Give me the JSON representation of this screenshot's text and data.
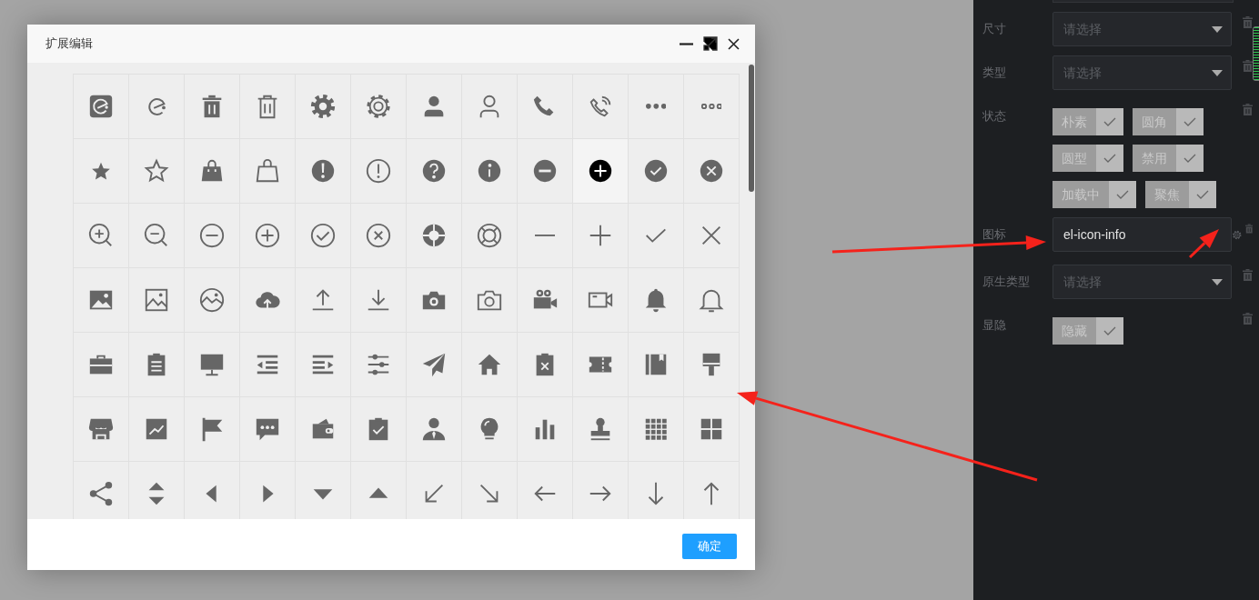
{
  "dialog": {
    "title": "扩展编辑",
    "icon_grid": {
      "rows": [
        {
          "cells": [
            {
              "selected": false
            },
            {
              "selected": false
            },
            {
              "selected": false
            },
            {
              "selected": false
            },
            {
              "selected": false
            },
            {
              "selected": false
            },
            {
              "selected": false
            },
            {
              "selected": false
            },
            {
              "selected": false
            },
            {
              "selected": false
            },
            {
              "selected": false
            },
            {
              "selected": false
            }
          ]
        },
        {
          "cells": [
            {
              "selected": false
            },
            {
              "selected": false
            },
            {
              "selected": false
            },
            {
              "selected": false
            },
            {
              "selected": false
            },
            {
              "selected": false
            },
            {
              "selected": false
            },
            {
              "selected": false
            },
            {
              "selected": false
            },
            {
              "selected": true
            },
            {
              "selected": false
            },
            {
              "selected": false
            }
          ]
        },
        {
          "cells": [
            {
              "selected": false
            },
            {
              "selected": false
            },
            {
              "selected": false
            },
            {
              "selected": false
            },
            {
              "selected": false
            },
            {
              "selected": false
            },
            {
              "selected": false
            },
            {
              "selected": false
            },
            {
              "selected": false
            },
            {
              "selected": false
            },
            {
              "selected": false
            },
            {
              "selected": false
            }
          ]
        },
        {
          "cells": [
            {
              "selected": false
            },
            {
              "selected": false
            },
            {
              "selected": false
            },
            {
              "selected": false
            },
            {
              "selected": false
            },
            {
              "selected": false
            },
            {
              "selected": false
            },
            {
              "selected": false
            },
            {
              "selected": false
            },
            {
              "selected": false
            },
            {
              "selected": false
            },
            {
              "selected": false
            }
          ]
        },
        {
          "cells": [
            {
              "selected": false
            },
            {
              "selected": false
            },
            {
              "selected": false
            },
            {
              "selected": false
            },
            {
              "selected": false
            },
            {
              "selected": false
            },
            {
              "selected": false
            },
            {
              "selected": false
            },
            {
              "selected": false
            },
            {
              "selected": false
            },
            {
              "selected": false
            },
            {
              "selected": false
            }
          ]
        },
        {
          "cells": [
            {
              "selected": false
            },
            {
              "selected": false
            },
            {
              "selected": false
            },
            {
              "selected": false
            },
            {
              "selected": false
            },
            {
              "selected": false
            },
            {
              "selected": false
            },
            {
              "selected": false
            },
            {
              "selected": false
            },
            {
              "selected": false
            },
            {
              "selected": false
            },
            {
              "selected": false
            }
          ]
        },
        {
          "cells": [
            {
              "selected": false
            },
            {
              "selected": false
            },
            {
              "selected": false
            },
            {
              "selected": false
            },
            {
              "selected": false
            },
            {
              "selected": false
            },
            {
              "selected": false
            },
            {
              "selected": false
            },
            {
              "selected": false
            },
            {
              "selected": false
            },
            {
              "selected": false
            },
            {
              "selected": false
            }
          ]
        }
      ]
    },
    "confirm_button": "确定"
  },
  "properties_panel": {
    "fields": [
      {
        "kind": "select",
        "label": "尺寸",
        "placeholder": "请选择"
      },
      {
        "kind": "select",
        "label": "类型",
        "placeholder": "请选择"
      },
      {
        "kind": "options",
        "label": "状态",
        "rows": [
          {
            "options": [
              {
                "label": "朴素",
                "checked": true
              },
              {
                "label": "圆角",
                "checked": true
              }
            ]
          },
          {
            "options": [
              {
                "label": "圆型",
                "checked": true
              },
              {
                "label": "禁用",
                "checked": true
              }
            ]
          },
          {
            "options": [
              {
                "label": "加载中",
                "checked": true
              },
              {
                "label": "聚焦",
                "checked": true
              }
            ]
          }
        ]
      },
      {
        "kind": "icon",
        "label": "图标",
        "value": "el-icon-info"
      },
      {
        "kind": "select",
        "label": "原生类型",
        "placeholder": "请选择"
      },
      {
        "kind": "options",
        "label": "显隐",
        "rows": [
          {
            "options": [
              {
                "label": "隐藏",
                "checked": true
              }
            ]
          }
        ]
      }
    ]
  }
}
